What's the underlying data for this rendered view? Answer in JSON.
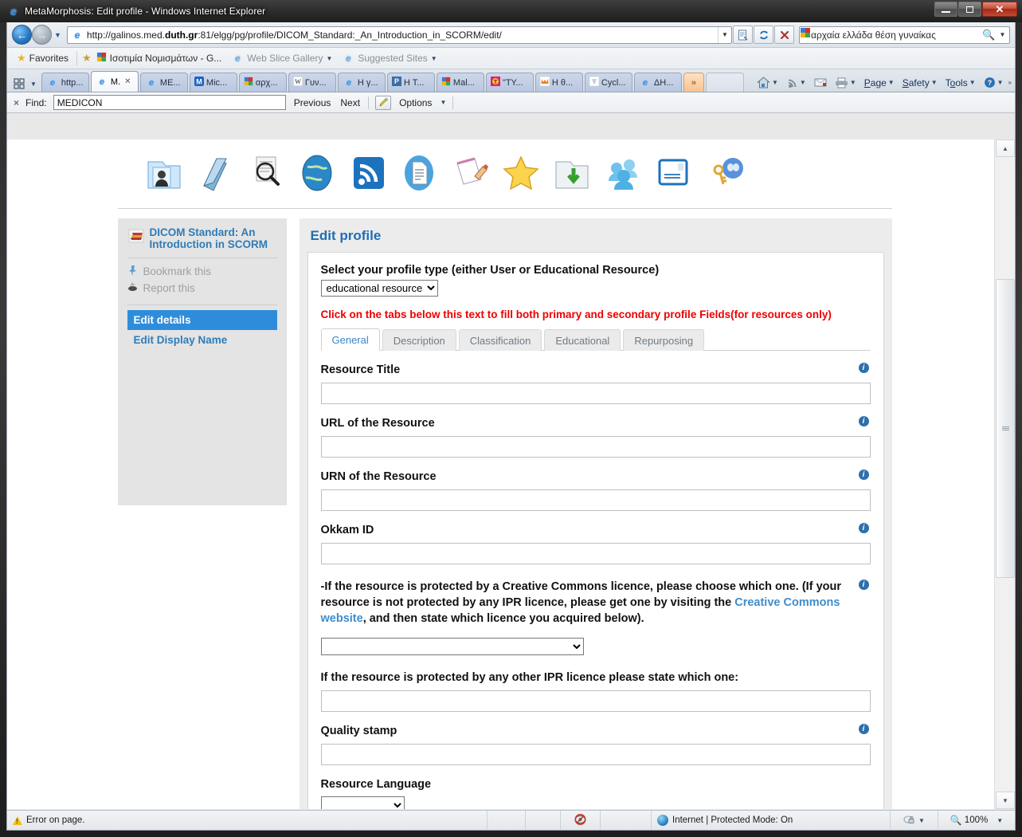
{
  "window": {
    "title": "MetaMorphosis: Edit profile - Windows Internet Explorer",
    "minimize_label": "Minimize",
    "maximize_label": "Maximize",
    "close_label": "Close"
  },
  "nav": {
    "back_label": "Back",
    "forward_label": "Forward",
    "url_prefix": "http://galinos.med.",
    "url_domain": "duth.gr",
    "url_suffix": ":81/elgg/pg/profile/DICOM_Standard:_An_Introduction_in_SCORM/edit/",
    "compat_label": "Compatibility View",
    "refresh_label": "Refresh",
    "stop_label": "Stop",
    "search_query": "αρχαία ελλάδα θέση γυναίκας",
    "search_go_label": "Search"
  },
  "favorites_bar": {
    "favorites_label": "Favorites",
    "items": [
      {
        "label": "Ισοτιμία Νομισμάτων - G...",
        "icon": "google-icon"
      },
      {
        "label": "Web Slice Gallery",
        "icon": "ie-icon",
        "has_caret": true
      },
      {
        "label": "Suggested Sites",
        "icon": "ie-icon",
        "has_caret": true
      }
    ]
  },
  "tabs": {
    "quick_tabs_label": "Quick Tabs",
    "tab_list_label": "Tab List",
    "items": [
      {
        "label": "http...",
        "icon": "ie-icon",
        "active": false
      },
      {
        "label": "M.",
        "icon": "ie-icon",
        "active": true,
        "closable": true
      },
      {
        "label": "ME...",
        "icon": "ie-icon",
        "active": false
      },
      {
        "label": "Mic...",
        "icon": "m-icon",
        "active": false
      },
      {
        "label": "αρχ...",
        "icon": "google-icon",
        "active": false
      },
      {
        "label": "Γυν...",
        "icon": "wikipedia-icon",
        "active": false
      },
      {
        "label": "Η γ...",
        "icon": "ie-icon",
        "active": false
      },
      {
        "label": "Η Τ...",
        "icon": "p-icon",
        "active": false
      },
      {
        "label": "Mal...",
        "icon": "google-icon",
        "active": false
      },
      {
        "label": "\"ΤΥ...",
        "icon": "t-icon",
        "active": false
      },
      {
        "label": "Η θ...",
        "icon": "fox-icon",
        "active": false
      },
      {
        "label": "Cycl...",
        "icon": "tooth-icon",
        "active": false
      },
      {
        "label": "ΔΗ...",
        "icon": "ie-icon",
        "active": false
      },
      {
        "label": "»",
        "icon": "overflow-icon",
        "active": false,
        "kind": "overflow"
      },
      {
        "label": "",
        "icon": "new-tab-icon",
        "active": false,
        "kind": "blank"
      }
    ],
    "toolbar": [
      {
        "label": "",
        "icon": "home-icon",
        "caret": true
      },
      {
        "label": "",
        "icon": "feeds-icon",
        "caret": true
      },
      {
        "label": "",
        "icon": "mail-icon",
        "caret": false
      },
      {
        "label": "",
        "icon": "print-icon",
        "caret": true
      },
      {
        "label": "Page",
        "icon": "",
        "caret": true
      },
      {
        "label": "Safety",
        "icon": "",
        "caret": true
      },
      {
        "label": "Tools",
        "icon": "",
        "caret": true
      },
      {
        "label": "",
        "icon": "help-icon",
        "caret": true
      }
    ],
    "overflow_label": "»"
  },
  "find_bar": {
    "close_label": "×",
    "find_label": "Find:",
    "query": "MEDICON",
    "placeholder": "",
    "previous_label": "Previous",
    "next_label": "Next",
    "highlight_label": "Highlight all matches",
    "options_label": "Options"
  },
  "page": {
    "icon_strip": [
      "profile-folder-icon",
      "book-icon",
      "search-magnifier-icon",
      "globe-icon",
      "rss-feed-icon",
      "document-icon",
      "notepad-pencil-icon",
      "star-icon",
      "folder-download-icon",
      "group-users-icon",
      "card-icon",
      "keys-avatar-icon"
    ],
    "sidebar": {
      "resource_title": "DICOM Standard: An Introduction in SCORM",
      "resource_icon": "books-icon",
      "actions": [
        {
          "label": "Bookmark this",
          "icon": "pin-icon"
        },
        {
          "label": "Report this",
          "icon": "report-icon"
        }
      ],
      "links": [
        {
          "label": "Edit details",
          "selected": true
        },
        {
          "label": "Edit Display Name",
          "selected": false
        }
      ]
    },
    "main": {
      "heading": "Edit profile",
      "profile_type_label": "Select your profile type (either User or Educational Resource)",
      "profile_type_value": "educational resource",
      "profile_type_options": [
        "educational resource",
        "user"
      ],
      "warning": "Click on the tabs below this text to fill both primary and secondary profile Fields(for resources only)",
      "tabs": [
        {
          "label": "General",
          "active": true
        },
        {
          "label": "Description",
          "active": false
        },
        {
          "label": "Classification",
          "active": false
        },
        {
          "label": "Educational",
          "active": false
        },
        {
          "label": "Repurposing",
          "active": false
        }
      ],
      "fields": [
        {
          "label": "Resource Title",
          "value": "",
          "type": "text",
          "info": true
        },
        {
          "label": "URL of the Resource",
          "value": "",
          "type": "text",
          "info": true
        },
        {
          "label": "URN of the Resource",
          "value": "",
          "type": "text",
          "info": true
        },
        {
          "label": "Okkam ID",
          "value": "",
          "type": "text",
          "info": true
        }
      ],
      "cc_label_part1": "-If the resource is protected by a Creative Commons licence, please choose which one. (If your resource is not protected by any IPR licence, please get one by visiting the ",
      "cc_link_text": "Creative Commons website",
      "cc_label_part2": ", and then state which licence you acquired below).",
      "cc_select_value": "",
      "cc_select_options": [
        ""
      ],
      "other_ipr_label": "If the resource is protected by any other IPR licence please state which one:",
      "other_ipr_value": "",
      "quality_stamp_label": "Quality stamp",
      "quality_stamp_value": "",
      "resource_language_label": "Resource Language",
      "resource_language_value": "",
      "resource_language_options": [
        ""
      ]
    }
  },
  "status_bar": {
    "error_text": "Error on page.",
    "error_icon": "warning-icon",
    "blocked_icon": "popup-blocked-icon",
    "zone_text": "Internet | Protected Mode: On",
    "zone_icon": "internet-zone-icon",
    "privacy_icon": "privacy-lock-icon",
    "zoom_level": "100%"
  },
  "colors": {
    "link_blue": "#2e7cb8",
    "selected_blue": "#2e8ddb",
    "warning_red": "#ee0000",
    "heading_blue": "#1f6db5"
  }
}
